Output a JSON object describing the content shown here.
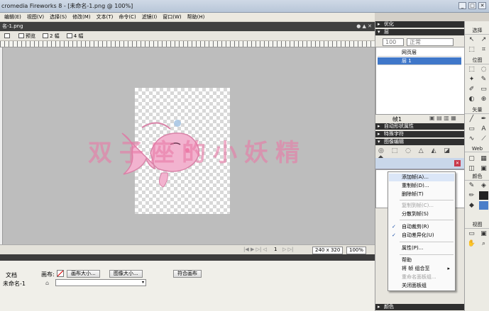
{
  "window": {
    "title": "cromedia Fireworks 8 - [未命名-1.png @ 100%]"
  },
  "menu": [
    "编辑(E)",
    "视图(V)",
    "选择(S)",
    "修改(M)",
    "文本(T)",
    "命令(C)",
    "滤镜(I)",
    "窗口(W)",
    "帮助(H)"
  ],
  "document": {
    "tab": "名-1.png",
    "views": [
      "预览",
      "2 幅",
      "4 幅"
    ],
    "controls": "● ▲ ✕"
  },
  "status": {
    "frame": "1",
    "size": "240 x 320",
    "zoom": "100%"
  },
  "properties": {
    "label_doc": "文档",
    "doc_name": "未命名-1",
    "canvas_label": "画布:",
    "canvas_size_btn": "画布大小...",
    "image_size_btn": "图像大小...",
    "fit_canvas_btn": "符合画布"
  },
  "panels": {
    "optimize": "优化",
    "layers": "层",
    "opacity": "100",
    "blend": "正常",
    "layer_web": "网页层",
    "layer_1": "层 1",
    "frame": "帧1",
    "auto_shape": "自动形状属性",
    "special_chars": "特殊字符",
    "image_edit": "图像编辑",
    "colors": "颜色"
  },
  "tools": {
    "select": "选择",
    "bitmap": "位图",
    "vector": "矢量",
    "web": "Web",
    "colors": "颜色",
    "view": "视图"
  },
  "context_menu": {
    "items": [
      {
        "label": "添加帧(A)...",
        "disabled": false,
        "checked": false
      },
      {
        "label": "重制帧(D)...",
        "disabled": false,
        "checked": false
      },
      {
        "label": "删除帧(T)",
        "disabled": false,
        "checked": false
      },
      {
        "label": "复制到帧(C)...",
        "disabled": true,
        "checked": false
      },
      {
        "label": "分散到帧(S)",
        "disabled": false,
        "checked": false
      },
      {
        "label": "自动裁剪(R)",
        "disabled": false,
        "checked": true
      },
      {
        "label": "自动差异化(U)",
        "disabled": false,
        "checked": true
      },
      {
        "label": "属性(P)...",
        "disabled": false,
        "checked": false
      },
      {
        "label": "帮助",
        "disabled": false,
        "checked": false
      },
      {
        "label": "将 帧 组合至",
        "disabled": false,
        "checked": false,
        "submenu": true
      },
      {
        "label": "重命名面板组...",
        "disabled": true,
        "checked": false
      },
      {
        "label": "关闭面板组",
        "disabled": false,
        "checked": false
      }
    ]
  },
  "watermark": "双子座的小妖精"
}
